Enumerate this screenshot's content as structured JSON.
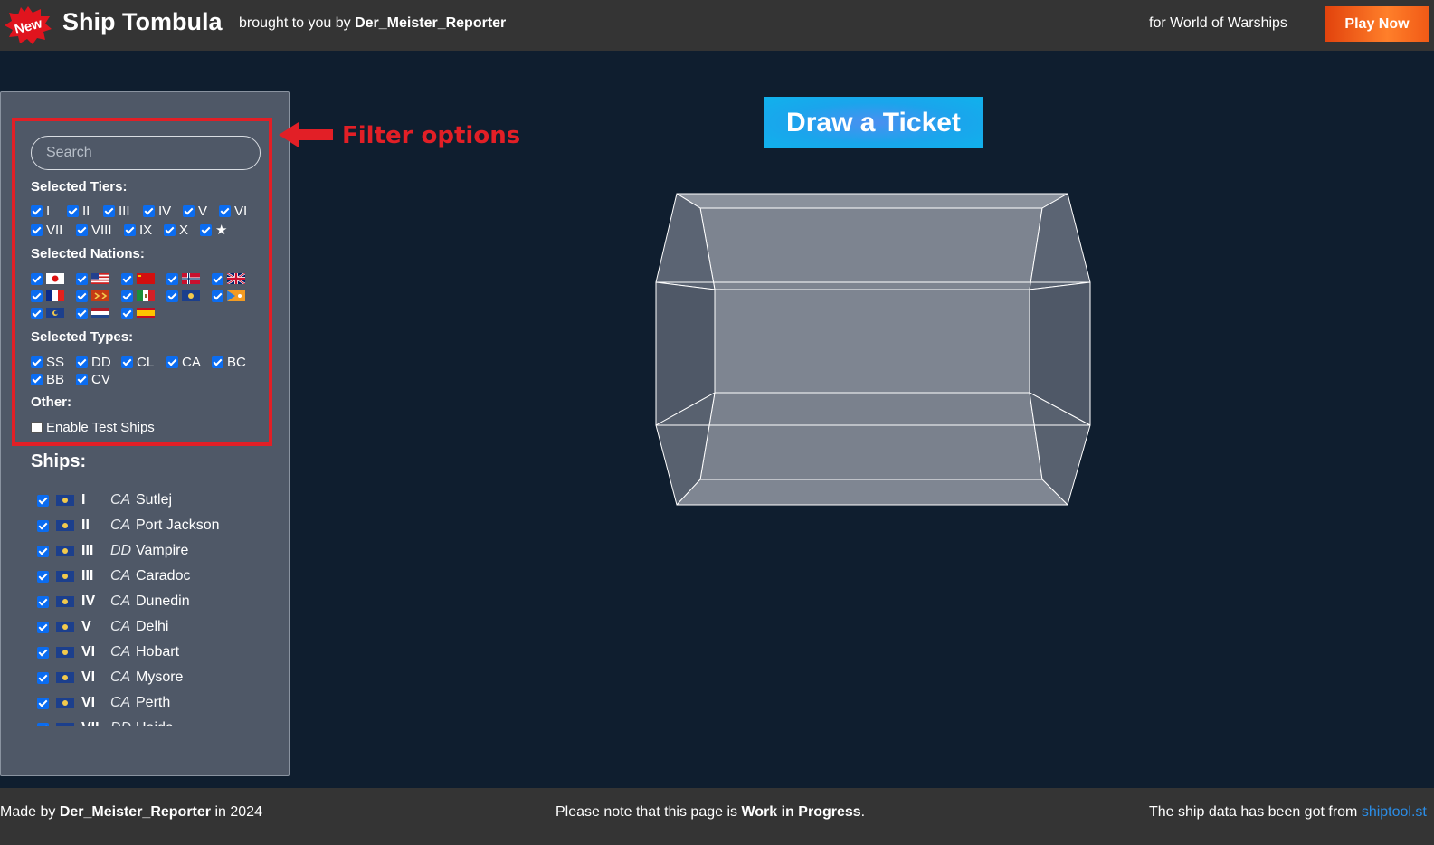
{
  "header": {
    "badge": "New",
    "brand": "Ship Tombula",
    "byline_prefix": "brought to you by",
    "byline_author": "Der_Meister_Reporter",
    "for_game": "for World of Warships",
    "play_now": "Play Now"
  },
  "annotation": {
    "text": "Filter options"
  },
  "filters": {
    "search_placeholder": "Search",
    "tiers_label": "Selected Tiers:",
    "tiers": [
      "I",
      "II",
      "III",
      "IV",
      "V",
      "VI",
      "VII",
      "VIII",
      "IX",
      "X",
      "★"
    ],
    "nations_label": "Selected Nations:",
    "nations": [
      "japan-flag",
      "usa-flag",
      "ussr-flag",
      "europe-flag",
      "uk-flag",
      "france-flag",
      "germany-flag",
      "italy-flag",
      "commonwealth-flag",
      "panamerica-flag",
      "panasia-flag",
      "netherlands-flag",
      "spain-flag"
    ],
    "types_label": "Selected Types:",
    "types": [
      "SS",
      "DD",
      "CL",
      "CA",
      "BC",
      "BB",
      "CV"
    ],
    "other_label": "Other:",
    "test_ships_label": "Enable Test Ships"
  },
  "ships": {
    "title": "Ships:",
    "items": [
      {
        "tier": "I",
        "type": "CA",
        "name": "Sutlej"
      },
      {
        "tier": "II",
        "type": "CA",
        "name": "Port Jackson"
      },
      {
        "tier": "III",
        "type": "DD",
        "name": "Vampire"
      },
      {
        "tier": "III",
        "type": "CA",
        "name": "Caradoc"
      },
      {
        "tier": "IV",
        "type": "CA",
        "name": "Dunedin"
      },
      {
        "tier": "V",
        "type": "CA",
        "name": "Delhi"
      },
      {
        "tier": "VI",
        "type": "CA",
        "name": "Hobart"
      },
      {
        "tier": "VI",
        "type": "CA",
        "name": "Mysore"
      },
      {
        "tier": "VI",
        "type": "CA",
        "name": "Perth"
      },
      {
        "tier": "VII",
        "type": "DD",
        "name": "Haida"
      }
    ]
  },
  "main": {
    "draw_button": "Draw a Ticket"
  },
  "footer": {
    "made_by_prefix": "Made by",
    "made_by_author": "Der_Meister_Reporter",
    "made_by_suffix": "in 2024",
    "note_prefix": "Please note that this page is",
    "note_bold": "Work in Progress",
    "note_suffix": ".",
    "data_source_prefix": "The ship data has been got from",
    "data_source_link": "shiptool.st"
  },
  "colors": {
    "background": "#0f1e2f",
    "header": "#343434",
    "sidebar": "#4f5867",
    "annotation": "#e21f26",
    "draw_button": "#10b2ec",
    "play_now": "#ff7f2a",
    "link": "#2b8de6"
  }
}
